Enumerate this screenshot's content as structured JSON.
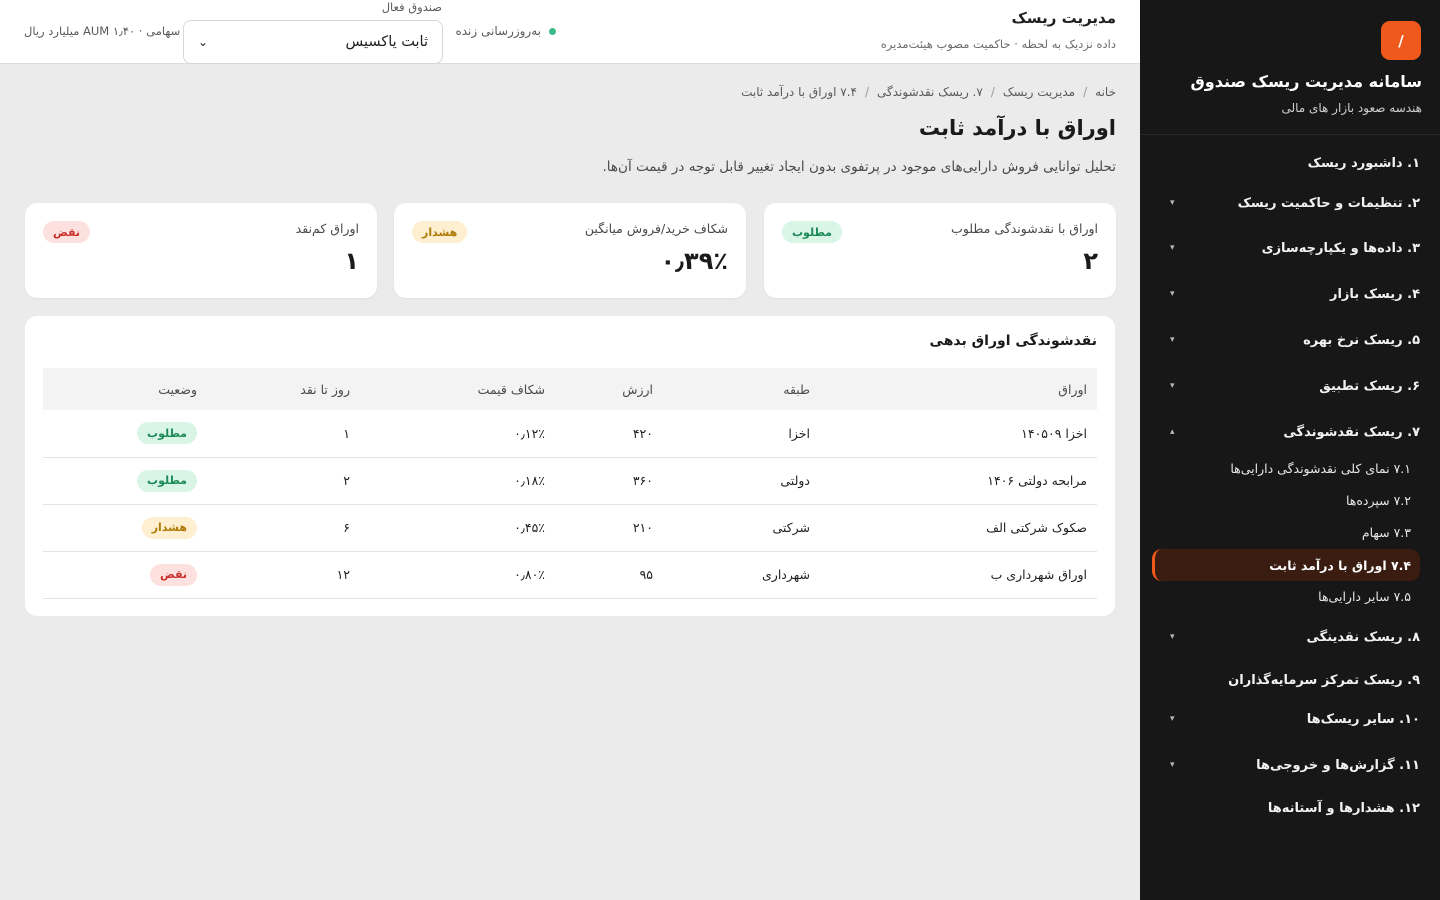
{
  "sidebar": {
    "logo_glyph": "/",
    "title": "سامانه مدیریت ریسک صندوق",
    "subtitle": "هندسه صعود بازار های مالی",
    "items": [
      {
        "label": "۱. داشبورد ریسک",
        "has_chevron": false
      },
      {
        "label": "۲. تنظیمات و حاکمیت ریسک",
        "has_chevron": true
      },
      {
        "label": "۳. داده‌ها و یکپارچه‌سازی",
        "has_chevron": true
      },
      {
        "label": "۴. ریسک بازار",
        "has_chevron": true
      },
      {
        "label": "۵. ریسک نرخ بهره",
        "has_chevron": true
      },
      {
        "label": "۶. ریسک تطبیق",
        "has_chevron": true
      },
      {
        "label": "۷. ریسک نقدشوندگی",
        "has_chevron": true,
        "expanded": true
      },
      {
        "label": "۸. ریسک نقدینگی",
        "has_chevron": true
      },
      {
        "label": "۹. ریسک تمرکز سرمایه‌گذاران",
        "has_chevron": false
      },
      {
        "label": "۱۰. سایر ریسک‌ها",
        "has_chevron": true
      },
      {
        "label": "۱۱. گزارش‌ها و خروجی‌ها",
        "has_chevron": true
      },
      {
        "label": "۱۲. هشدارها و آستانه‌ها",
        "has_chevron": false
      }
    ],
    "subitems": [
      {
        "label": "۷.۱ نمای کلی نقدشوندگی دارایی‌ها",
        "active": false
      },
      {
        "label": "۷.۲ سپرده‌ها",
        "active": false
      },
      {
        "label": "۷.۳ سهام",
        "active": false
      },
      {
        "label": "۷.۴ اوراق با درآمد ثابت",
        "active": true
      },
      {
        "label": "۷.۵ سایر دارایی‌ها",
        "active": false
      }
    ],
    "chevron_down": "▾",
    "chevron_up": "▴"
  },
  "header": {
    "title": "مدیریت ریسک",
    "subtitle": "داده نزدیک به لحظه · حاکمیت مصوب هیئت‌مدیره",
    "live_text": "به‌روزرسانی زنده",
    "fund_label": "صندوق فعال",
    "fund_value": "ثابت یاکسیس",
    "aum": "سهامی · AUM ۱٫۴۰ میلیارد ریال"
  },
  "breadcrumb": [
    "خانه",
    "مدیریت ریسک",
    "۷. ریسک نقدشوندگی",
    "۷.۴ اوراق با درآمد ثابت"
  ],
  "page": {
    "title": "اوراق با درآمد ثابت",
    "description": "تحلیل توانایی فروش دارایی‌های موجود در پرتفوی بدون ایجاد تغییر قابل توجه در قیمت آن‌ها."
  },
  "cards": [
    {
      "title": "اوراق با نقدشوندگی مطلوب",
      "value": "۲",
      "badge": "مطلوب",
      "status": "ok"
    },
    {
      "title": "شکاف خرید/فروش میانگین",
      "value": "۰٫۳۹٪",
      "badge": "هشدار",
      "status": "warn"
    },
    {
      "title": "اوراق کم‌نقد",
      "value": "۱",
      "badge": "نقض",
      "status": "bad"
    }
  ],
  "table": {
    "title": "نقدشوندگی اوراق بدهی",
    "columns": [
      "اوراق",
      "طبقه",
      "ارزش",
      "شکاف قیمت",
      "روز تا نقد",
      "وضعیت"
    ],
    "rows": [
      {
        "name": "اخزا ۱۴۰۵۰۹",
        "class": "اخزا",
        "value": "۴۲۰",
        "spread": "۰٫۱۲٪",
        "days": "۱",
        "status_label": "مطلوب",
        "status": "ok"
      },
      {
        "name": "مرابحه دولتی ۱۴۰۶",
        "class": "دولتی",
        "value": "۳۶۰",
        "spread": "۰٫۱۸٪",
        "days": "۲",
        "status_label": "مطلوب",
        "status": "ok"
      },
      {
        "name": "صکوک شرکتی الف",
        "class": "شرکتی",
        "value": "۲۱۰",
        "spread": "۰٫۴۵٪",
        "days": "۶",
        "status_label": "هشدار",
        "status": "warn"
      },
      {
        "name": "اوراق شهرداری ب",
        "class": "شهرداری",
        "value": "۹۵",
        "spread": "۰٫۸۰٪",
        "days": "۱۲",
        "status_label": "نقض",
        "status": "bad"
      }
    ]
  },
  "colors": {
    "accent": "#f0591c",
    "sidebar_bg": "#171717",
    "ok": "#1b8a56",
    "warn": "#b07a0a",
    "bad": "#c9302c",
    "live_dot": "#3dbb87"
  }
}
